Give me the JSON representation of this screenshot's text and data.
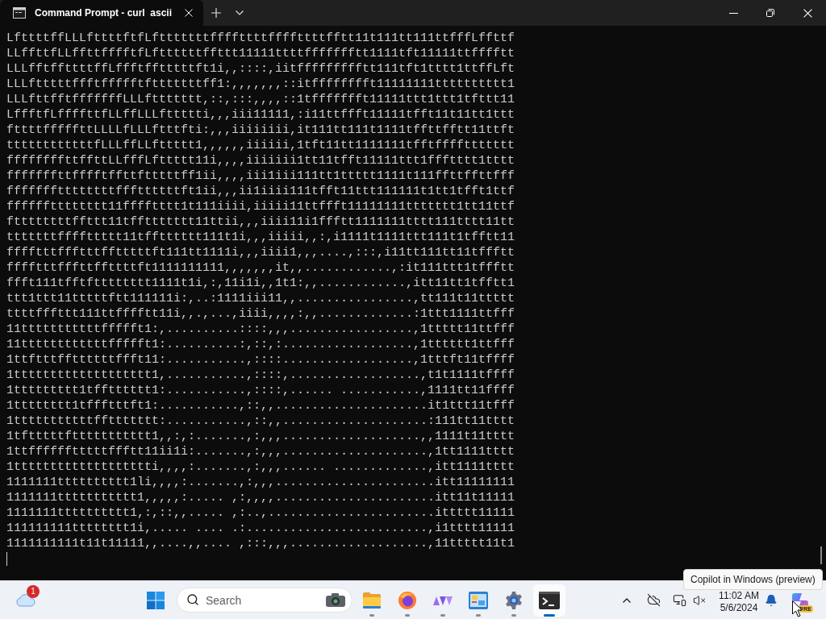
{
  "window": {
    "tabs": [
      {
        "title": "Command Prompt - curl  ascii",
        "selected": true
      }
    ]
  },
  "terminal": {
    "lines": [
      "LfttttffLLLfttttftfLftttttttffffttttffffttttfftt11t111tt111ttfffLffttf",
      "LLffttfLLffttfffftfLfttttttffttt11111ttttffffffftt1111tft11111ttfffftt",
      "LLLfftffttttffLffftfftttttft1i,,::::,iitffffffffftt111tft1tttt1ttffLft",
      "LLLftttttffftffffftftttttttff1:,,,,,,,::itfffffffft11111111tttttttttt1",
      "LLLfttfftfffffffLLLfttttttt,::,:::,,,,::1tffffffft11111ttt1ttt1tfttt11",
      "LffftfLffffttfLLffLLLfttttti,,,iii11111,:i11ttffft11111tfft11t11tt1ttt",
      "fttttfffffttLLLLfLLLftttfti:,,,iiiiiiii,it111tt111t1111tffttfftt11ttft",
      "ttttttttttttfLLLffLLfttttt1,,,,,,iiiiii,1tft11tt1111111tfftffffttttttt",
      "ffffffffttffttLLfffLfttttt11i,,,,iiiiiii1tt11tfft11111ttt1ffftttt1tttt",
      "fffffffttfffftffttftttttff1ii,,,,iii1iii111tt1ttttt1111t111ffttffttfff",
      "fffffffttttttttfffttttttft1ii,,,ii1iiii111tfft11ttt111111t1tt1tfft1ttf",
      "fffffftttttttt11fffftttt1t111iiii,iiiii11ttffft11111111ttttttt1tt11ttf",
      "fttttttttffttt11tffttttttt11ttii,,,iiii11i1ffftt1111111tttt111tttt11tt",
      "tttttttffffttttt11tfftttttt111t1i,,,iiiii,,:,i1111t1111ttt111t1tfftt11",
      "fffftttffftttfftttttft111tt1111i,,,iiii1,,,....,:::,i11tt111tt11tffftt",
      "fffftttfffttffttttft1111111111,,,,,,,it,,............,:it111ttt1tffftt",
      "ffft111tfftftttttttt1111t1i,:,11i1i,,1t1:,,............,itt11tt1tfftt1",
      "ttt1ttt11tttttftt111111i:,..:1111iii11,,................,tt111t11ttttt",
      "ttttfffttt111ttfffftt11i,,.,...,iiii,,,,:,,.............:1ttt1111ttfff",
      "11tttttttttttffffft1:,..........::::,,,.................,1ttttt11ttfff",
      "11ttttttttttttffffft1:..........:,::,:..................,1tttttt1ttfff",
      "1ttftttffttttttffft11:...........,::::..................,1tttft11tffff",
      "1ttttttttttttttttttt1,...........,::::,..................,t1t1111tffff",
      "1ttttttttt1tfftttttt1:...........,::::,...... ...........,1111tt11ffff",
      "1tttttttt1tffftttft1:...........,::,,.....................it1ttt11tfff",
      "1tttttttttttffttttttt:...........,::,,....................:111tt11tttt",
      "1tftttttfttttttttttt1,,:,:.......,:,,,...................,,1111t11tttt",
      "1ttfffffftttttffftt11ii1i:.......,:,,,....................,1tt1111tttt",
      "1ttttttttttttttttttti,,,,:.......,:,,,...... .............,itt1111tttt",
      "1111111tttttttttt1li,,,,:.......,:,,,......................itt11111111",
      "1111111ttttttttttt1,,,,,:..... ,:,,,,......................itt11t11111",
      "1111111tttttttttt1,:,::,,..... ,:..,.......................ittttt11111",
      "111111111tttttttt1i,..... .... .:.........................,i1tttt11111",
      "1111111111t11t11111,,....,,.... ,:::,,,...................,11ttttt11t1"
    ],
    "cursor": true
  },
  "tooltip": {
    "text": "Copilot in Windows (preview)"
  },
  "taskbar": {
    "widgets": {
      "badge": "1"
    },
    "search": {
      "placeholder": "Search"
    },
    "apps": [
      {
        "kind": "folder",
        "selected": false
      },
      {
        "kind": "browser",
        "selected": false
      },
      {
        "kind": "shapes",
        "selected": false
      },
      {
        "kind": "control-panel",
        "selected": false
      },
      {
        "kind": "settings",
        "selected": false
      },
      {
        "kind": "terminal",
        "selected": true
      }
    ],
    "clock": {
      "time": "11:02 AM",
      "date": "5/6/2024"
    },
    "copilot": {
      "badge": "PRE"
    }
  }
}
